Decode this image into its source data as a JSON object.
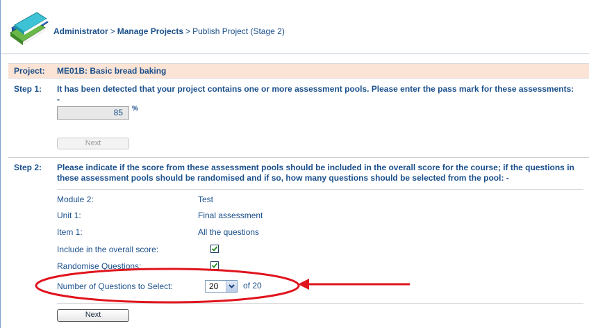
{
  "breadcrumb": {
    "part1": "Administrator",
    "part2": "Manage Projects",
    "part3": "Publish Project (Stage 2)",
    "separator": ">"
  },
  "project": {
    "label": "Project:",
    "value": "ME01B: Basic bread baking"
  },
  "step1": {
    "label": "Step 1:",
    "text": "It has been detected that your project contains one or more assessment pools. Please enter the pass mark for these assessments: -",
    "pass_mark": "85",
    "unit": "%",
    "next_label": "Next",
    "next_enabled": false
  },
  "step2": {
    "label": "Step 2:",
    "text": "Please indicate if the score from these assessment pools should be included in the overall score for the course; if the questions in these assessment pools should be randomised and if so, how many questions should be selected from the pool: -",
    "rows": [
      {
        "label": "Module 2:",
        "value": "Test"
      },
      {
        "label": "Unit 1:",
        "value": "Final assessment"
      },
      {
        "label": "Item 1:",
        "value": "All the questions"
      },
      {
        "label": "Include in the overall score:",
        "checked": true
      },
      {
        "label": "Randomise Questions:",
        "checked": true
      },
      {
        "label": "Number of Questions to Select:",
        "selected": "20",
        "of_text": "of 20"
      }
    ],
    "next_label": "Next",
    "next_enabled": true
  },
  "colors": {
    "text": "#1a4f8b",
    "project_bg": "#fbe4d5",
    "annotation": "#e0141e"
  },
  "icons": {
    "logo": "books-stack-icon",
    "checkbox": "checkmark-icon",
    "dropdown": "chevron-down-icon",
    "annotation": "red-arrow-icon"
  }
}
